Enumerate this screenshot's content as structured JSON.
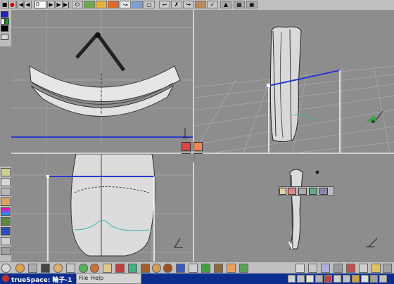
{
  "toolbar": {
    "frame_value": "0"
  },
  "taskbar": {
    "title": "trueSpace: 輪子-1"
  },
  "menu": {
    "file": "File",
    "help": "Help"
  },
  "colors": {
    "viewport_bg": "#8d8d8d",
    "grid_line": "#a3a3a3",
    "highlight_blue": "#2b39c8",
    "selection_white": "#ffffff",
    "taskbar_blue": "#0b2d8f",
    "toolbar_gray": "#c0c0c0"
  },
  "icons": {
    "top_toolbar": [
      "stop-icon",
      "record-icon",
      "first-frame-icon",
      "previous-frame-icon",
      "next-frame-icon",
      "last-frame-icon",
      "object-tool-icon",
      "eye-move-icon",
      "paint-icon",
      "render-icon",
      "zoom-icon",
      "rotate-icon",
      "scale-icon",
      "delete-icon",
      "undo-icon",
      "redo-icon",
      "camera-icon",
      "light-icon",
      "magnet-icon",
      "up-arrow-icon",
      "grid-icon",
      "help-icon"
    ],
    "bottom_toolbar": [
      "sphere-primitive-icon",
      "cylinder-primitive-icon",
      "material-icon",
      "cube-primitive-icon",
      "torus-icon",
      "knot-icon",
      "helix-icon",
      "star-icon",
      "spline-icon",
      "face-icon",
      "curve-icon",
      "cone-icon",
      "boolean-icon",
      "texture-icon",
      "checker-icon",
      "human-icon",
      "plant-icon",
      "smile-icon",
      "layers-icon"
    ],
    "tray": [
      "view-icon",
      "lock-icon",
      "grid-view-icon",
      "layout-icon",
      "scene-icon",
      "render-mode-icon",
      "zoom-view-icon",
      "pan-view-icon",
      "rotate-view-icon",
      "fit-view-icon",
      "maximize-icon",
      "restore-icon",
      "close-icon"
    ]
  }
}
